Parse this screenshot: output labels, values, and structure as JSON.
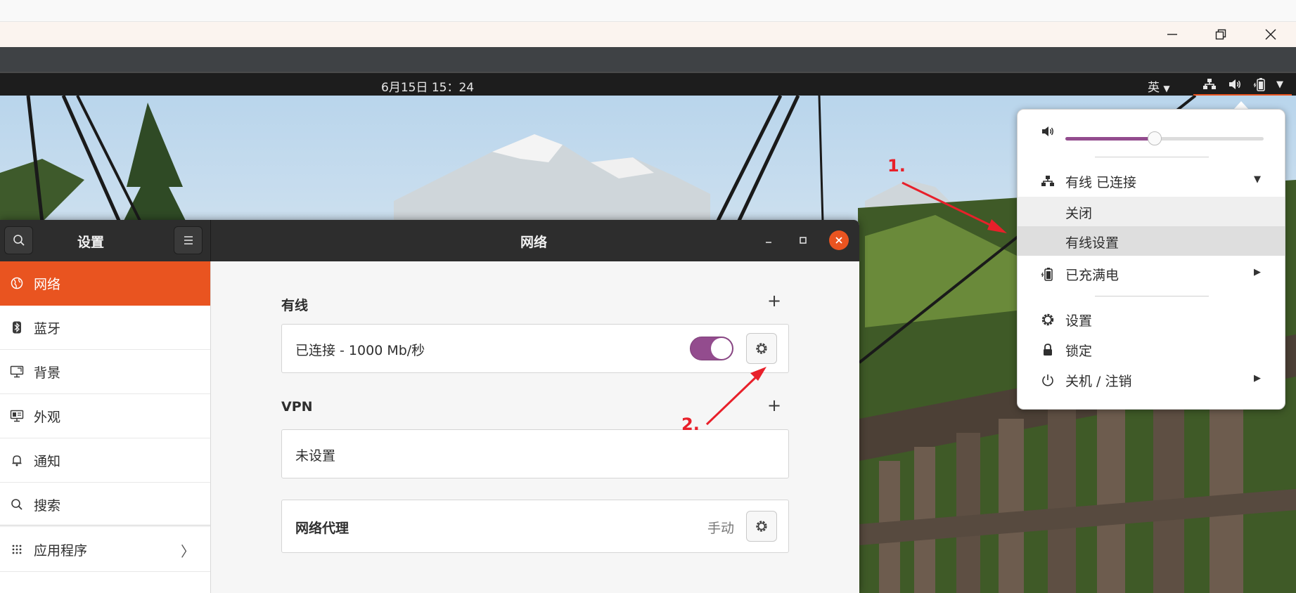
{
  "panel": {
    "clock": "6月15日  15：24",
    "input_method": "英"
  },
  "sysmenu": {
    "volume_fraction": 0.45,
    "wired_label": "有线 已连接",
    "wired_off": "关闭",
    "wired_settings": "有线设置",
    "battery_label": "已充满电",
    "settings_label": "设置",
    "lock_label": "锁定",
    "power_label": "关机 / 注销"
  },
  "settings": {
    "sidebar_title": "设置",
    "window_title": "网络",
    "sidebar_items": [
      {
        "label": "网络"
      },
      {
        "label": "蓝牙"
      },
      {
        "label": "背景"
      },
      {
        "label": "外观"
      },
      {
        "label": "通知"
      },
      {
        "label": "搜索"
      },
      {
        "label": "应用程序"
      }
    ],
    "wired_section": "有线",
    "wired_status": "已连接 - 1000 Mb/秒",
    "wired_enabled": true,
    "vpn_section": "VPN",
    "vpn_status": "未设置",
    "proxy_label": "网络代理",
    "proxy_value": "手动"
  },
  "annotations": {
    "step1": "1.",
    "step2": "2."
  },
  "colors": {
    "accent": "#e95420",
    "toggle": "#934c8e",
    "annotation": "#e8202a"
  }
}
